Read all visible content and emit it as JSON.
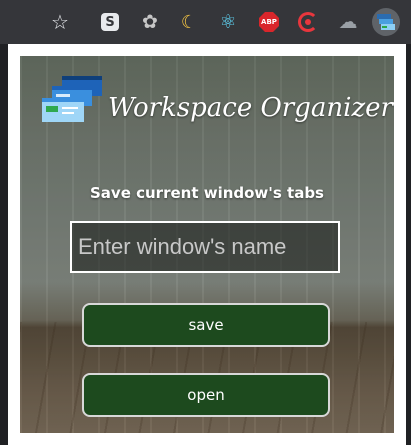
{
  "app": {
    "title": "Workspace Organizer",
    "heading": "Save current window's tabs"
  },
  "form": {
    "name_placeholder": "Enter window's name",
    "name_value": ""
  },
  "actions": {
    "save_label": "save",
    "open_label": "open"
  },
  "toolbar": {
    "extensions": [
      {
        "icon": "star-icon"
      },
      {
        "icon": "s-extension-icon",
        "label": "S"
      },
      {
        "icon": "fan-extension-icon"
      },
      {
        "icon": "moon-extension-icon"
      },
      {
        "icon": "react-devtools-icon"
      },
      {
        "icon": "adblock-plus-icon",
        "label": "ABP"
      },
      {
        "icon": "target-extension-icon"
      },
      {
        "icon": "cloud-extension-icon"
      },
      {
        "icon": "workspace-organizer-icon"
      }
    ]
  },
  "colors": {
    "button_bg": "#1d4a1e",
    "button_border": "#d8d8d8",
    "toolbar_bg": "#35363a",
    "popup_border": "#ffffff"
  }
}
